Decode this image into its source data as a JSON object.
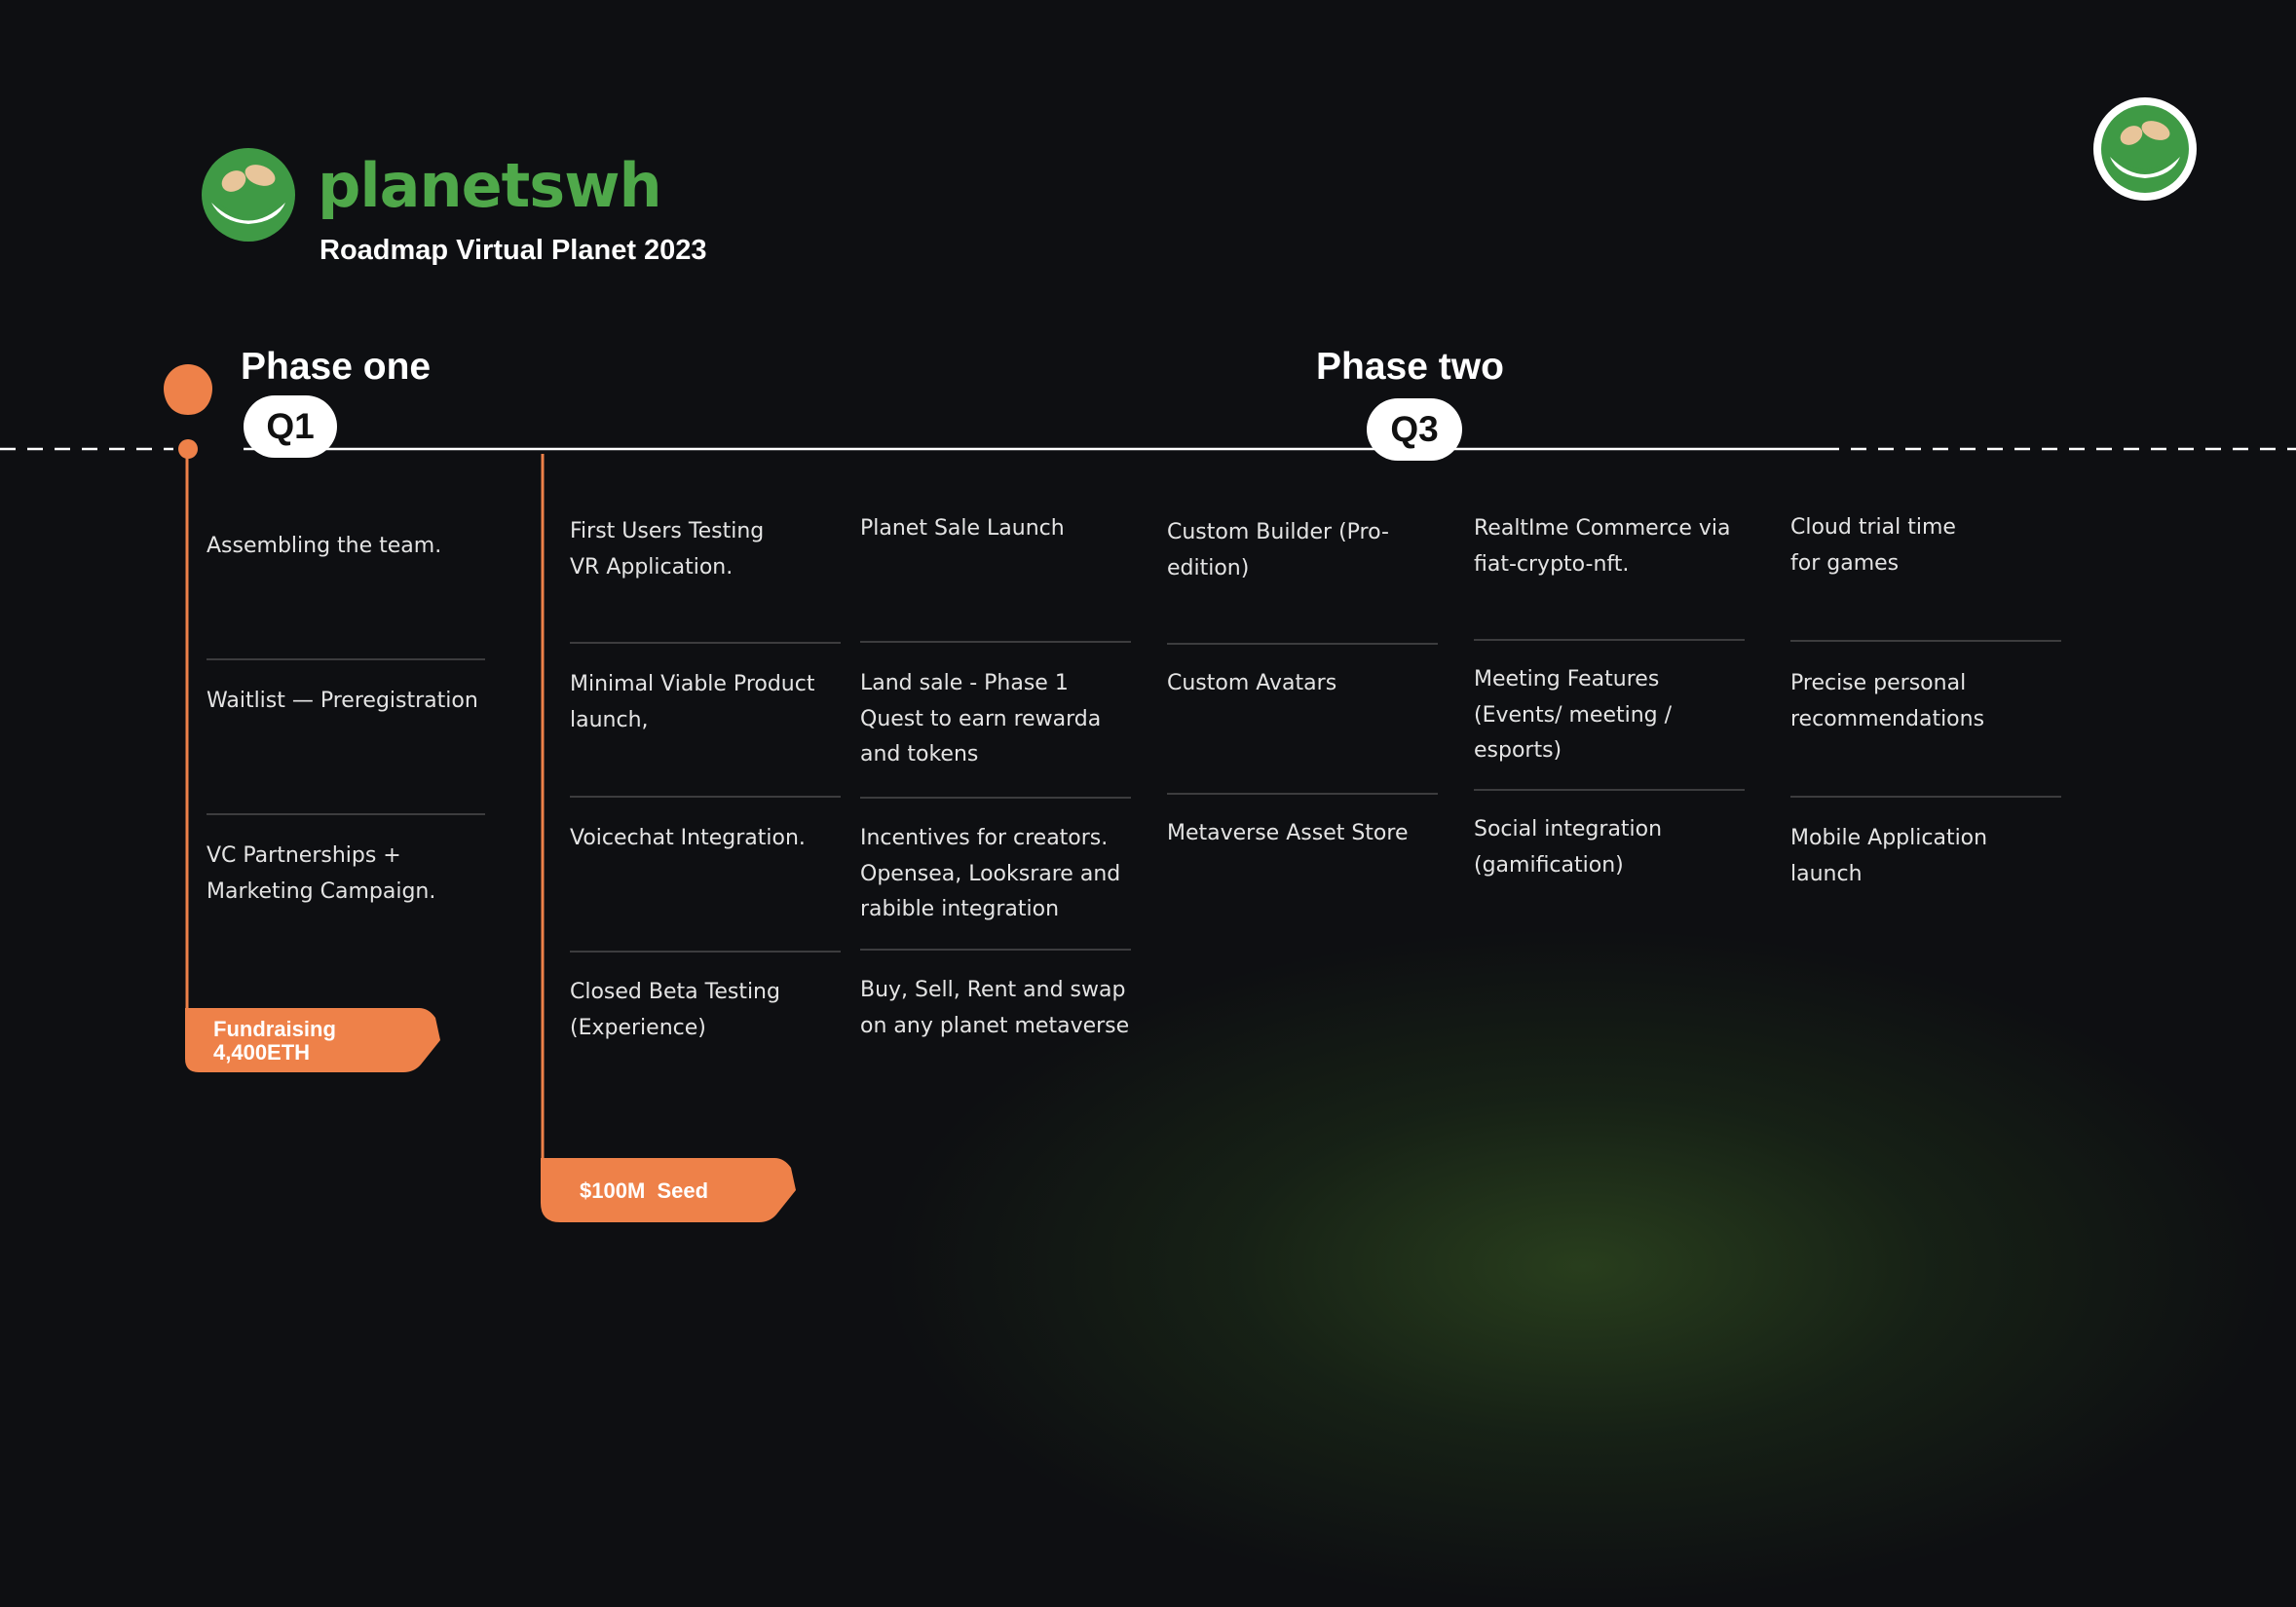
{
  "brand": {
    "name": "planetswh",
    "subtitle": "Roadmap Virtual Planet 2023",
    "colors": {
      "accent": "#ee8149",
      "brand_green": "#4fa84a",
      "background": "#0e0f12"
    },
    "logo_icon": "planet-logo-icon"
  },
  "phases": [
    {
      "title": "Phase one",
      "quarter": "Q1"
    },
    {
      "title": "Phase two",
      "quarter": "Q3"
    }
  ],
  "columns": [
    {
      "items": [
        "Assembling the team.",
        "Waitlist — Preregistration",
        "VC Partnerships +\nMarketing Campaign."
      ]
    },
    {
      "items": [
        "First Users Testing\nVR Application.",
        "Minimal Viable Product\nlaunch,",
        "Voicechat Integration.",
        "Closed Beta Testing\n(Experience)"
      ]
    },
    {
      "items": [
        "Planet Sale Launch",
        "Land sale - Phase 1\nQuest to earn rewarda\nand tokens",
        "Incentives for creators.\nOpensea, Looksrare and\nrabible integration",
        "Buy, Sell, Rent and swap\non any planet metaverse"
      ]
    },
    {
      "items": [
        "Custom Builder (Pro-\nedition)",
        "Custom Avatars",
        "Metaverse Asset Store"
      ]
    },
    {
      "items": [
        "RealtIme Commerce via\nfiat-crypto-nft.",
        "Meeting Features\n(Events/ meeting /\nesports)",
        "Social integration\n(gamification)"
      ]
    },
    {
      "items": [
        "Cloud trial time\nfor games",
        "Precise personal\nrecommendations",
        "Mobile Application\nlaunch"
      ]
    }
  ],
  "tags": [
    {
      "label": "Fundraising\n4,400ETH"
    },
    {
      "label": "$100M  Seed"
    }
  ]
}
